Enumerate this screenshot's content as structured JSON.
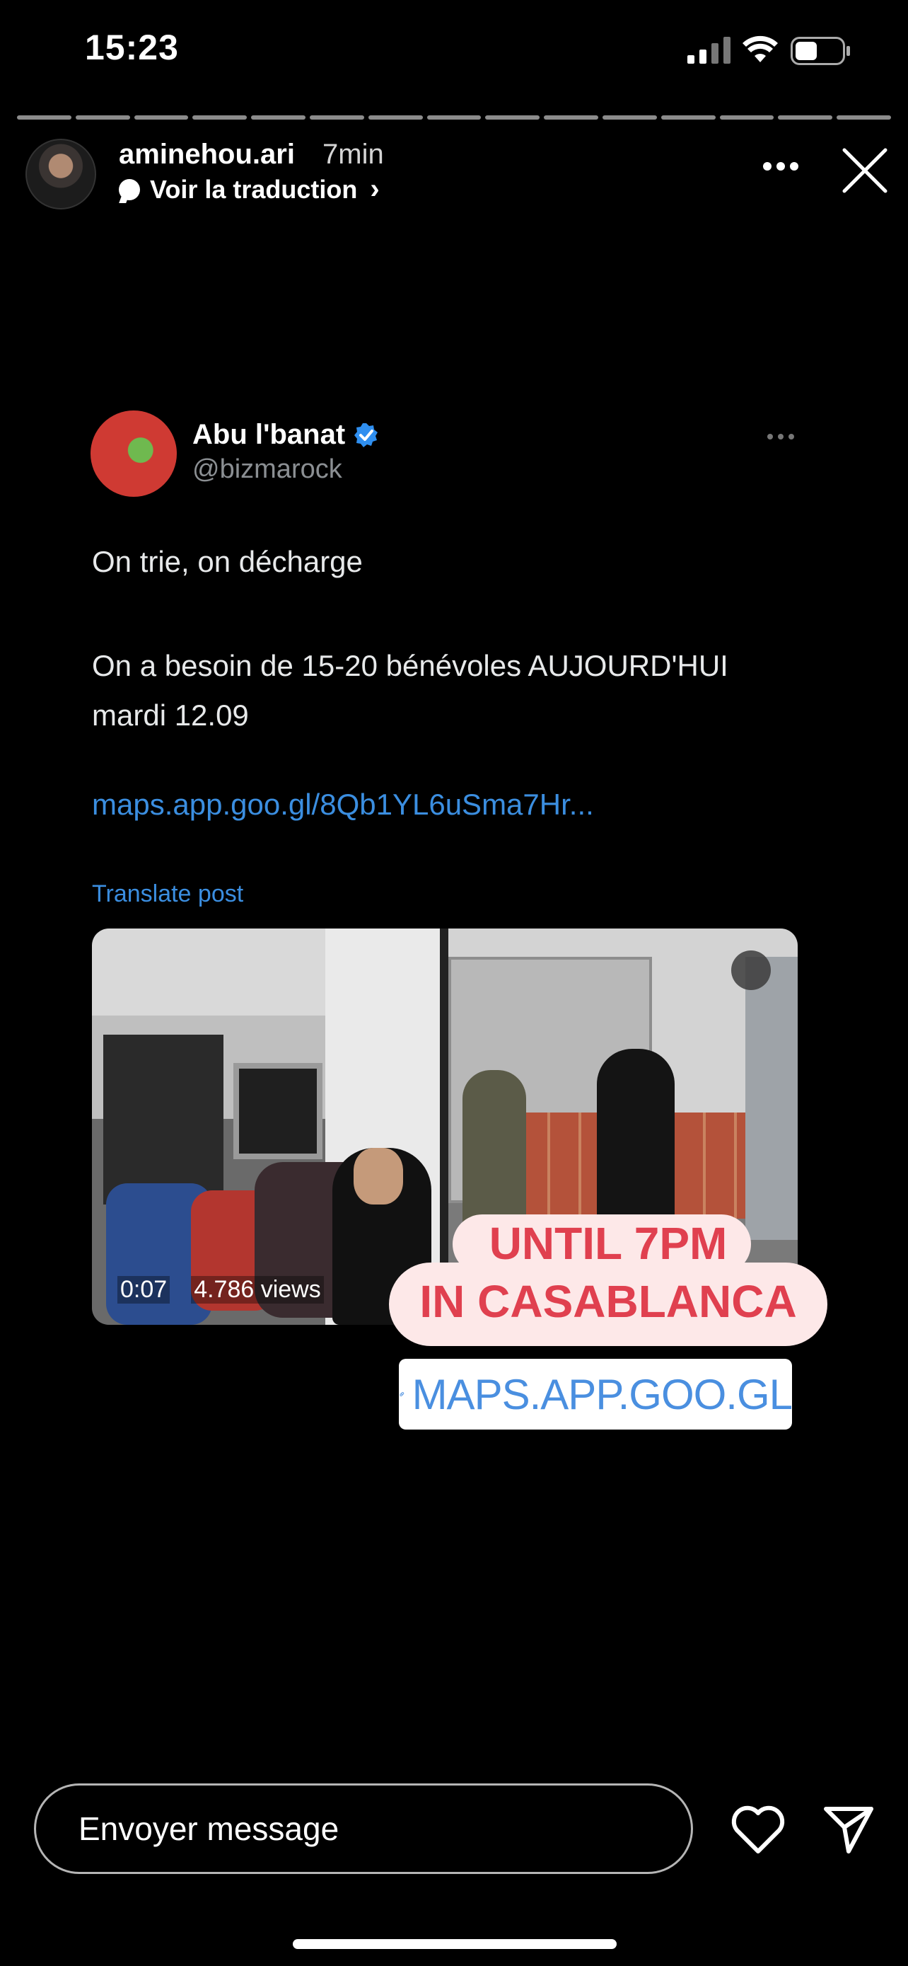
{
  "status_bar": {
    "time": "15:23",
    "signal_icon": "signal-icon",
    "wifi_icon": "wifi-icon",
    "battery_icon": "battery-icon"
  },
  "story": {
    "segments": 15,
    "username": "aminehou.ari",
    "age": "7min",
    "translate_label": "Voir la traduction",
    "more_icon": "more-dots-icon",
    "close_icon": "close-icon"
  },
  "tweet": {
    "name": "Abu l'banat",
    "handle": "@bizmarock",
    "text1": "On trie, on décharge",
    "text2": "On a besoin de 15-20 bénévoles AUJOURD'HUI mardi 12.09",
    "link": "maps.app.goo.gl/8Qb1YL6uSma7Hr...",
    "translate_label": "Translate post",
    "video_duration": "0:07",
    "video_views": "4.786 views"
  },
  "stickers": {
    "line1": "UNTIL 7PM",
    "line2": "IN CASABLANCA",
    "link_label": "MAPS.APP.GOO.GL",
    "text_color": "#e0404f",
    "link_color": "#4a8fe0"
  },
  "footer": {
    "message_placeholder": "Envoyer message",
    "like_icon": "heart-icon",
    "send_icon": "send-icon"
  }
}
